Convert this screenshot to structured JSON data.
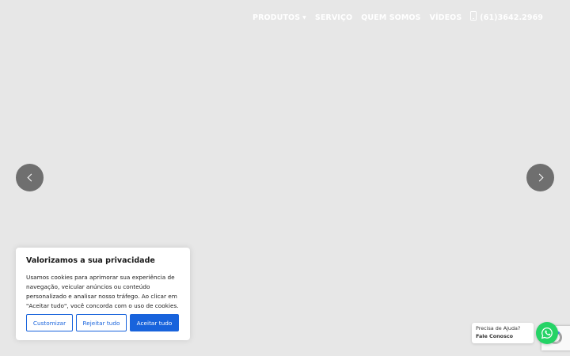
{
  "nav": {
    "items": [
      {
        "label": "PRODUTOS",
        "has_dropdown": true
      },
      {
        "label": "SERVIÇO"
      },
      {
        "label": "QUEM SOMOS"
      },
      {
        "label": "VÍDEOS"
      }
    ],
    "phone_icon": "mobile-phone-icon",
    "phone": "(61)3642.2969"
  },
  "carousel": {
    "prev_icon": "chevron-left-icon",
    "next_icon": "chevron-right-icon"
  },
  "cookie_banner": {
    "title": "Valorizamos a sua privacidade",
    "text": "Usamos cookies para aprimorar sua experiência de navegação, veicular anúncios ou conteúdo personalizado e analisar nosso tráfego. Ao clicar em \"Aceitar tudo\", você concorda com o uso de cookies.",
    "customize_label": "Customizar",
    "reject_label": "Rejeitar tudo",
    "accept_label": "Aceitar tudo"
  },
  "help_bubble": {
    "prefix": "Precisa de Ajuda?",
    "cta": "Fale Conosco"
  },
  "whatsapp": {
    "icon": "whatsapp-icon"
  },
  "colors": {
    "accent": "#1863dc",
    "whatsapp": "#25d366",
    "hero_bg": "#e7e7e7",
    "arrow_bg": "#6f6f6f"
  }
}
